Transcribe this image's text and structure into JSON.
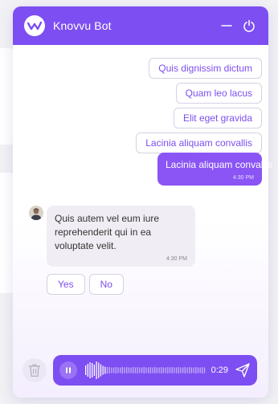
{
  "header": {
    "title": "Knovvu Bot"
  },
  "options": [
    "Quis dignissim dictum",
    "Quam leo lacus",
    "Elit eget gravida",
    "Lacinia aliquam convallis"
  ],
  "user_message": {
    "text": "Lacinia aliquam convallis",
    "time": "4:30 PM"
  },
  "bot_message": {
    "text": "Quis autem vel eum iure reprehenderit qui in ea voluptate velit.",
    "time": "4:30 PM"
  },
  "quick_replies": [
    "Yes",
    "No"
  ],
  "recorder": {
    "duration": "0:29"
  },
  "colors": {
    "brand": "#7d4ef1",
    "user_bubble": "#8a55f4"
  },
  "icons": {
    "logo": "knovvu-logo-icon",
    "minimize": "minimize-icon",
    "power": "power-icon",
    "trash": "trash-icon",
    "pause": "pause-icon",
    "send": "send-icon"
  }
}
